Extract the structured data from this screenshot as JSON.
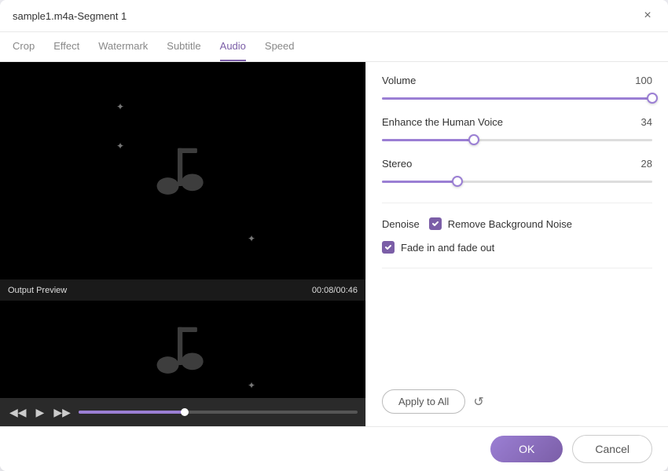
{
  "window": {
    "title": "sample1.m4a-Segment 1",
    "close_label": "×"
  },
  "tabs": [
    {
      "label": "Crop",
      "active": false
    },
    {
      "label": "Effect",
      "active": false
    },
    {
      "label": "Watermark",
      "active": false
    },
    {
      "label": "Subtitle",
      "active": false
    },
    {
      "label": "Audio",
      "active": true
    },
    {
      "label": "Speed",
      "active": false
    }
  ],
  "preview": {
    "output_label": "Output Preview",
    "time_display": "00:08/00:46"
  },
  "audio": {
    "volume_label": "Volume",
    "volume_value": "100",
    "volume_pct": 100,
    "enhance_label": "Enhance the Human Voice",
    "enhance_value": "34",
    "enhance_pct": 34,
    "stereo_label": "Stereo",
    "stereo_value": "28",
    "stereo_pct": 28,
    "denoise_label": "Denoise",
    "remove_bg_noise_label": "Remove Background Noise",
    "fade_label": "Fade in and fade out",
    "apply_all_label": "Apply to All"
  },
  "footer": {
    "ok_label": "OK",
    "cancel_label": "Cancel"
  }
}
